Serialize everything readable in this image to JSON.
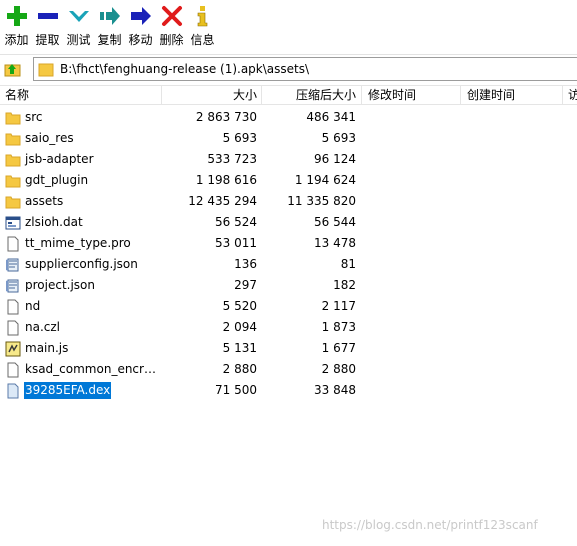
{
  "toolbar": {
    "add": "添加",
    "extract": "提取",
    "test": "测试",
    "copy": "复制",
    "move": "移动",
    "delete": "删除",
    "info": "信息"
  },
  "address": {
    "path": "B:\\fhct\\fenghuang-release (1).apk\\assets\\"
  },
  "columns": {
    "name": "名称",
    "size": "大小",
    "packed": "压缩后大小",
    "modified": "修改时间",
    "created": "创建时间",
    "more": "访"
  },
  "files": [
    {
      "name": "src",
      "size": "2 863 730",
      "packed": "486 341",
      "icon": "folder-icon"
    },
    {
      "name": "saio_res",
      "size": "5 693",
      "packed": "5 693",
      "icon": "folder-icon"
    },
    {
      "name": "jsb-adapter",
      "size": "533 723",
      "packed": "96 124",
      "icon": "folder-icon"
    },
    {
      "name": "gdt_plugin",
      "size": "1 198 616",
      "packed": "1 194 624",
      "icon": "folder-icon"
    },
    {
      "name": "assets",
      "size": "12 435 294",
      "packed": "11 335 820",
      "icon": "folder-icon"
    },
    {
      "name": "zlsioh.dat",
      "size": "56 524",
      "packed": "56 544",
      "icon": "dat-file-icon"
    },
    {
      "name": "tt_mime_type.pro",
      "size": "53 011",
      "packed": "13 478",
      "icon": "file-icon"
    },
    {
      "name": "supplierconfig.json",
      "size": "136",
      "packed": "81",
      "icon": "json-file-icon"
    },
    {
      "name": "project.json",
      "size": "297",
      "packed": "182",
      "icon": "json-file-icon"
    },
    {
      "name": "nd",
      "size": "5 520",
      "packed": "2 117",
      "icon": "file-icon"
    },
    {
      "name": "na.czl",
      "size": "2 094",
      "packed": "1 873",
      "icon": "file-icon"
    },
    {
      "name": "main.js",
      "size": "5 131",
      "packed": "1 677",
      "icon": "script-file-icon"
    },
    {
      "name": "ksad_common_encry...",
      "size": "2 880",
      "packed": "2 880",
      "icon": "file-icon"
    },
    {
      "name": "39285EFA.dex",
      "size": "71 500",
      "packed": "33 848",
      "icon": "dex-file-icon",
      "selected": true
    }
  ],
  "watermark": "https://blog.csdn.net/printf123scanf",
  "colors": {
    "selection": "#0078d7",
    "folder": "#f5c842",
    "add_green": "#16a816",
    "extract_blue": "#1a22b8",
    "test_cyan": "#1aa3b8",
    "delete_red": "#e01b1b",
    "info_yellow": "#e8c020"
  }
}
